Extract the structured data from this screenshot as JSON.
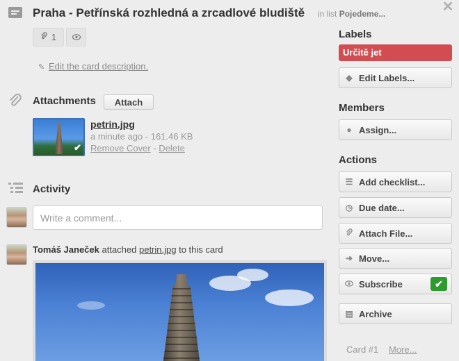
{
  "header": {
    "title": "Praha - Petřínská rozhledná a zrcadlové bludiště",
    "in_list_prefix": "in list",
    "list_name": "Pojedeme...",
    "close_glyph": "✕"
  },
  "badges": {
    "attachment_count": "1"
  },
  "description": {
    "edit_link": "Edit the card description."
  },
  "attachments": {
    "heading": "Attachments",
    "attach_button": "Attach",
    "file": {
      "name": "petrin.jpg",
      "meta": "a minute ago - 161.46 KB",
      "remove_cover": "Remove Cover",
      "separator": " - ",
      "delete": "Delete"
    }
  },
  "activity": {
    "heading": "Activity",
    "comment_placeholder": "Write a comment...",
    "entry": {
      "user": "Tomáš Janeček",
      "verb": " attached ",
      "file": "petrin.jpg",
      "suffix": " to this card"
    }
  },
  "sidebar": {
    "labels_heading": "Labels",
    "label_chip": "Určitě jet",
    "edit_labels": "Edit Labels...",
    "members_heading": "Members",
    "assign": "Assign...",
    "actions_heading": "Actions",
    "add_checklist": "Add checklist...",
    "due_date": "Due date...",
    "attach_file": "Attach File...",
    "move": "Move...",
    "subscribe": "Subscribe",
    "archive": "Archive"
  },
  "footer": {
    "card_number": "Card #1",
    "more": "More..."
  },
  "colors": {
    "label_red": "#d24d52",
    "subscribe_green": "#2e9b2e",
    "cover_border": "#3b6fb6"
  }
}
